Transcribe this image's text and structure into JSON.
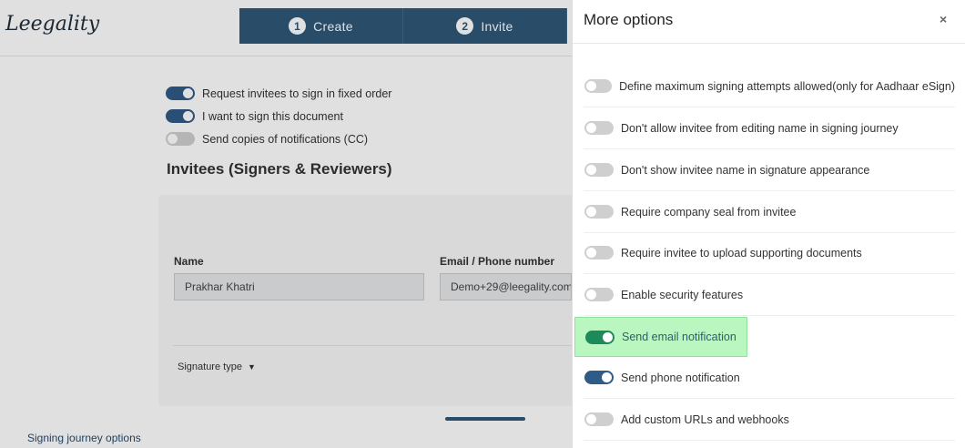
{
  "app": {
    "logo_text": "Leegality"
  },
  "steps": [
    {
      "number": "1",
      "label": "Create"
    },
    {
      "number": "2",
      "label": "Invite"
    }
  ],
  "settings": [
    {
      "label": "Request invitees to sign in fixed order",
      "on": true
    },
    {
      "label": "I want to sign this document",
      "on": true
    },
    {
      "label": "Send copies of notifications (CC)",
      "on": false
    }
  ],
  "invitees": {
    "title": "Invitees (Signers & Reviewers)",
    "name_label": "Name",
    "name_value": "Prakhar Khatri",
    "email_label": "Email / Phone number",
    "email_value": "Demo+29@leegality.com",
    "signature_type_label": "Signature type"
  },
  "footer": {
    "signing_journey_link": "Signing journey options"
  },
  "drawer": {
    "title": "More options",
    "close_glyph": "×",
    "options": [
      {
        "label": "Define maximum signing attempts allowed(only for Aadhaar eSign)",
        "on": false
      },
      {
        "label": "Don't allow invitee from editing name in signing journey",
        "on": false
      },
      {
        "label": "Don't show invitee name in signature appearance",
        "on": false
      },
      {
        "label": "Require company seal from invitee",
        "on": false
      },
      {
        "label": "Require invitee to upload supporting documents",
        "on": false
      },
      {
        "label": "Enable security features",
        "on": false
      },
      {
        "label": "Send email notification",
        "on": true,
        "highlighted": true
      },
      {
        "label": "Send phone notification",
        "on": true
      },
      {
        "label": "Add custom URLs and webhooks",
        "on": false
      }
    ]
  },
  "colors": {
    "primary": "#2f5878",
    "toggle_on": "#2f5b87",
    "highlight": "#baf7c0",
    "highlight_toggle": "#1e8a5a"
  }
}
